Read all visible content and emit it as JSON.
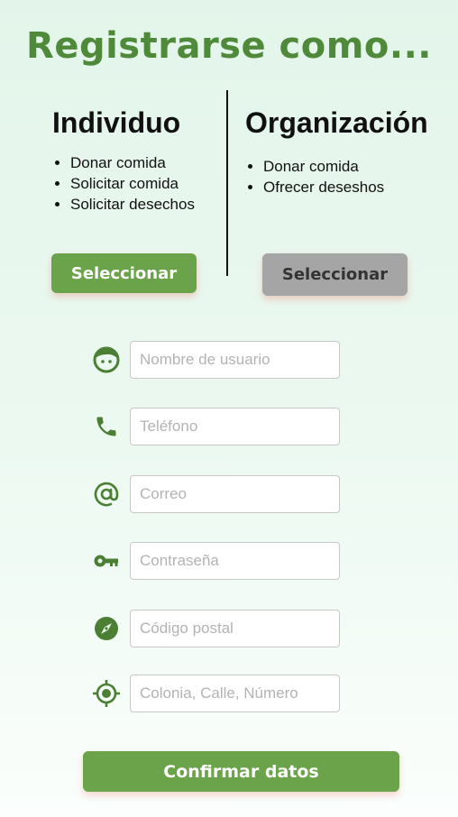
{
  "header": {
    "title": "Registrarse como..."
  },
  "individual": {
    "heading": "Individuo",
    "items": [
      "Donar comida",
      "Solicitar comida",
      "Solicitar desechos"
    ],
    "button_label": "Seleccionar"
  },
  "organization": {
    "heading": "Organización",
    "items": [
      "Donar comida",
      "Ofrecer deseshos"
    ],
    "button_label": "Seleccionar"
  },
  "form": {
    "fields": [
      {
        "icon": "user-face-icon",
        "placeholder": "Nombre de usuario",
        "value": ""
      },
      {
        "icon": "phone-icon",
        "placeholder": "Teléfono",
        "value": ""
      },
      {
        "icon": "at-sign-icon",
        "placeholder": "Correo",
        "value": ""
      },
      {
        "icon": "key-icon",
        "placeholder": "Contraseña",
        "value": ""
      },
      {
        "icon": "compass-icon",
        "placeholder": "Código postal",
        "value": ""
      },
      {
        "icon": "location-target-icon",
        "placeholder": "Colonia, Calle, Número",
        "value": ""
      }
    ],
    "confirm_label": "Confirmar datos"
  },
  "colors": {
    "accent_green": "#6aa349",
    "title_green": "#4f8a3a",
    "icon_green": "#4a7f34",
    "disabled_gray": "#a5a5a5"
  }
}
